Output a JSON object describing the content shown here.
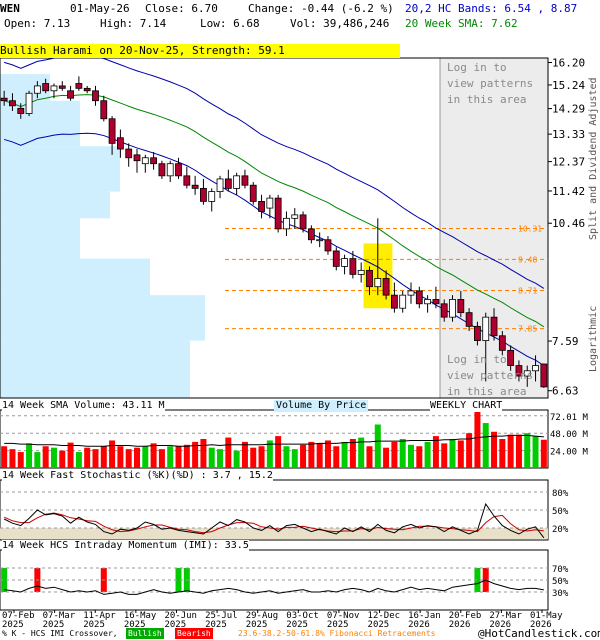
{
  "header": {
    "ticker": "WEN",
    "date": "01-May-26",
    "close": "Close: 6.70",
    "change": "Change: -0.44 (-6.2 %)",
    "open": "Open: 7.13",
    "high": "High: 7.14",
    "low": "Low: 6.68",
    "volume": "Vol: 39,486,246",
    "bands": "20,2 HC Bands: 6.54 , 8.87",
    "sma": "20 Week SMA: 7.62"
  },
  "banner": "Bullish Harami on 20-Nov-25, Strength: 59.1",
  "login_text": "Log in to\nview patterns\nin this area",
  "price_axis_label": "Split and Dividend Adjusted",
  "log_label": "Logarithmic",
  "volume_title": "14 Week SMA Volume: 43.11 M",
  "vbp_label": "Volume By Price",
  "weekly_label": "WEEKLY CHART",
  "stoch_title": "14 Week Fast Stochastic (%K)(%D) : 3.7 , 15.2",
  "hmi_title": "14 Week HCS Intraday Momentum (IMI): 33.5",
  "footer": {
    "legend_text": "% K - HCS IMI Crossover,",
    "bullish": "Bullish",
    "bearish": "Bearish",
    "fib": "23.6-38.2-50-61.8% Fibonacci Retracements",
    "copyright": "@HotCandlestick.com"
  },
  "colors": {
    "bull": "#00cc00",
    "bear": "#ff0000",
    "candle_bear": "#b00030",
    "sma": "#008800",
    "bands": "#0000aa",
    "fib": "#ff8000",
    "vbp": "#cfefff",
    "highlight": "#ffee00",
    "stoch_k": "#000000",
    "stoch_d": "#cc0000"
  },
  "chart_data": [
    {
      "type": "candlestick",
      "ticker": "WEN",
      "scale": "log",
      "ylim": [
        6.5,
        16.4
      ],
      "y_ticks": [
        16.2,
        15.24,
        14.29,
        13.33,
        12.37,
        11.42,
        10.46,
        7.59,
        6.63
      ],
      "x_labels": [
        "07-Feb\n2025",
        "07-Mar\n2025",
        "11-Apr\n2025",
        "16-May\n2025",
        "20-Jun\n2025",
        "25-Jul\n2025",
        "29-Aug\n2025",
        "03-Oct\n2025",
        "07-Nov\n2025",
        "12-Dec\n2025",
        "16-Jan\n2026",
        "20-Feb\n2026",
        "27-Mar\n2026",
        "01-May\n2026"
      ],
      "fib_levels": [
        10.31,
        9.48,
        8.71,
        7.85
      ],
      "weeks": 66,
      "ohlc": [
        [
          14.7,
          15.0,
          14.4,
          14.6
        ],
        [
          14.6,
          14.9,
          14.2,
          14.4
        ],
        [
          14.3,
          14.5,
          13.9,
          14.1
        ],
        [
          14.1,
          15.0,
          14.0,
          14.9
        ],
        [
          14.9,
          15.4,
          14.7,
          15.2
        ],
        [
          15.3,
          15.5,
          14.9,
          15.0
        ],
        [
          15.0,
          15.3,
          14.7,
          15.2
        ],
        [
          15.2,
          15.4,
          15.0,
          15.1
        ],
        [
          15.0,
          15.2,
          14.6,
          14.7
        ],
        [
          15.3,
          15.6,
          15.0,
          15.1
        ],
        [
          15.1,
          15.2,
          14.9,
          15.0
        ],
        [
          15.0,
          15.2,
          14.4,
          14.6
        ],
        [
          14.6,
          14.8,
          13.8,
          13.9
        ],
        [
          13.9,
          14.0,
          12.6,
          13.0
        ],
        [
          13.2,
          13.5,
          12.5,
          12.8
        ],
        [
          12.8,
          13.0,
          12.2,
          12.5
        ],
        [
          12.6,
          12.8,
          12.0,
          12.4
        ],
        [
          12.3,
          12.6,
          12.0,
          12.5
        ],
        [
          12.5,
          12.7,
          12.1,
          12.3
        ],
        [
          12.3,
          12.4,
          11.8,
          11.9
        ],
        [
          11.9,
          12.4,
          11.7,
          12.3
        ],
        [
          12.3,
          12.5,
          11.8,
          11.9
        ],
        [
          11.9,
          12.2,
          11.5,
          11.6
        ],
        [
          11.6,
          11.9,
          11.3,
          11.5
        ],
        [
          11.5,
          11.8,
          11.0,
          11.1
        ],
        [
          11.1,
          11.5,
          10.8,
          11.4
        ],
        [
          11.4,
          11.9,
          11.2,
          11.8
        ],
        [
          11.8,
          12.1,
          11.4,
          11.5
        ],
        [
          11.5,
          12.0,
          11.3,
          11.9
        ],
        [
          11.9,
          12.1,
          11.5,
          11.6
        ],
        [
          11.6,
          11.7,
          11.0,
          11.1
        ],
        [
          11.1,
          11.3,
          10.6,
          10.8
        ],
        [
          10.9,
          11.3,
          10.6,
          11.2
        ],
        [
          11.2,
          11.3,
          10.2,
          10.3
        ],
        [
          10.3,
          10.8,
          10.1,
          10.6
        ],
        [
          10.6,
          10.9,
          10.3,
          10.7
        ],
        [
          10.7,
          10.8,
          10.2,
          10.3
        ],
        [
          10.3,
          10.4,
          9.9,
          10.0
        ],
        [
          10.0,
          10.2,
          9.8,
          10.0
        ],
        [
          10.0,
          10.1,
          9.6,
          9.7
        ],
        [
          9.7,
          9.8,
          9.2,
          9.3
        ],
        [
          9.3,
          9.6,
          9.1,
          9.5
        ],
        [
          9.5,
          9.7,
          9.0,
          9.1
        ],
        [
          9.1,
          9.4,
          8.9,
          9.2
        ],
        [
          9.2,
          9.3,
          8.6,
          8.8
        ],
        [
          8.8,
          10.6,
          8.6,
          9.0
        ],
        [
          9.0,
          9.2,
          8.5,
          8.6
        ],
        [
          8.6,
          8.9,
          8.2,
          8.3
        ],
        [
          8.3,
          8.7,
          8.2,
          8.6
        ],
        [
          8.6,
          8.9,
          8.4,
          8.7
        ],
        [
          8.7,
          8.8,
          8.3,
          8.4
        ],
        [
          8.4,
          8.6,
          8.2,
          8.5
        ],
        [
          8.5,
          8.8,
          8.3,
          8.4
        ],
        [
          8.4,
          8.5,
          8.0,
          8.1
        ],
        [
          8.1,
          8.6,
          8.0,
          8.5
        ],
        [
          8.5,
          8.7,
          8.1,
          8.2
        ],
        [
          8.2,
          8.3,
          7.8,
          7.9
        ],
        [
          7.9,
          8.0,
          7.5,
          7.6
        ],
        [
          7.6,
          8.2,
          6.8,
          8.1
        ],
        [
          8.1,
          8.3,
          7.6,
          7.7
        ],
        [
          7.7,
          7.8,
          7.3,
          7.4
        ],
        [
          7.4,
          7.5,
          7.0,
          7.1
        ],
        [
          7.1,
          7.2,
          6.8,
          6.9
        ],
        [
          6.9,
          7.1,
          6.7,
          7.0
        ],
        [
          7.0,
          7.3,
          6.8,
          7.1
        ],
        [
          7.13,
          7.14,
          6.68,
          6.7
        ]
      ]
    },
    {
      "type": "bar",
      "title": "14 Week SMA Volume: 43.11 M",
      "y_ticks": [
        72.01,
        48.0,
        24.0
      ],
      "y_tick_labels": [
        "72.01 M",
        "48.00 M",
        "24.00 M"
      ],
      "ylim": [
        0,
        80
      ],
      "values": [
        30,
        26,
        22,
        34,
        22,
        30,
        28,
        24,
        35,
        22,
        28,
        26,
        30,
        38,
        30,
        26,
        28,
        30,
        34,
        26,
        30,
        30,
        32,
        36,
        40,
        28,
        26,
        42,
        24,
        36,
        28,
        30,
        38,
        44,
        30,
        26,
        32,
        36,
        34,
        38,
        30,
        36,
        40,
        42,
        30,
        60,
        28,
        36,
        40,
        32,
        30,
        36,
        44,
        34,
        40,
        38,
        48,
        80,
        62,
        50,
        40,
        46,
        46,
        48,
        44,
        39
      ],
      "up": [
        false,
        false,
        false,
        true,
        true,
        false,
        true,
        false,
        false,
        true,
        false,
        false,
        false,
        false,
        false,
        false,
        false,
        true,
        false,
        false,
        true,
        false,
        false,
        false,
        false,
        true,
        true,
        false,
        true,
        false,
        false,
        false,
        true,
        false,
        true,
        true,
        false,
        false,
        false,
        false,
        false,
        true,
        false,
        true,
        false,
        true,
        false,
        false,
        true,
        true,
        false,
        true,
        false,
        false,
        true,
        false,
        false,
        false,
        true,
        false,
        false,
        false,
        false,
        true,
        true,
        false
      ],
      "sma": [
        34,
        34,
        33,
        33,
        32,
        32,
        32,
        31,
        31,
        31,
        30,
        30,
        30,
        31,
        31,
        31,
        30,
        30,
        31,
        31,
        31,
        30,
        30,
        31,
        31,
        32,
        31,
        32,
        32,
        32,
        32,
        32,
        33,
        33,
        33,
        33,
        33,
        33,
        34,
        34,
        34,
        35,
        35,
        36,
        36,
        37,
        37,
        37,
        37,
        38,
        38,
        38,
        38,
        39,
        39,
        40,
        40,
        42,
        43,
        44,
        44,
        45,
        45,
        45,
        44,
        43
      ]
    },
    {
      "type": "line",
      "title": "14 Week Fast Stochastic (%K)(%D) : 3.7 , 15.2",
      "y_ticks": [
        80,
        50,
        20
      ],
      "y_tick_labels": [
        "80%",
        "50%",
        "20%"
      ],
      "ylim": [
        0,
        100
      ],
      "series": [
        {
          "name": "%K",
          "values": [
            35,
            28,
            24,
            36,
            50,
            42,
            44,
            40,
            28,
            38,
            30,
            26,
            14,
            10,
            18,
            16,
            20,
            30,
            26,
            18,
            20,
            16,
            14,
            12,
            10,
            20,
            30,
            24,
            34,
            30,
            20,
            16,
            24,
            14,
            24,
            26,
            20,
            14,
            18,
            14,
            10,
            20,
            14,
            22,
            14,
            26,
            16,
            12,
            22,
            26,
            20,
            24,
            22,
            14,
            22,
            16,
            10,
            16,
            60,
            40,
            24,
            16,
            10,
            18,
            22,
            3.7
          ]
        },
        {
          "name": "%D",
          "values": [
            38,
            32,
            29,
            29,
            37,
            43,
            45,
            42,
            37,
            35,
            32,
            31,
            23,
            17,
            14,
            15,
            18,
            22,
            25,
            25,
            21,
            18,
            17,
            14,
            12,
            14,
            20,
            25,
            29,
            29,
            28,
            22,
            20,
            18,
            21,
            21,
            23,
            20,
            17,
            15,
            14,
            15,
            15,
            19,
            17,
            21,
            19,
            18,
            17,
            20,
            23,
            23,
            22,
            20,
            19,
            17,
            16,
            14,
            29,
            39,
            41,
            27,
            17,
            15,
            17,
            15.2
          ]
        }
      ]
    },
    {
      "type": "line",
      "title": "14 Week HCS Intraday Momentum (IMI): 33.5",
      "y_ticks": [
        70,
        50,
        30
      ],
      "y_tick_labels": [
        "70%",
        "50%",
        "30%"
      ],
      "ylim": [
        0,
        100
      ],
      "values": [
        34,
        32,
        30,
        36,
        40,
        36,
        38,
        34,
        30,
        32,
        30,
        32,
        26,
        28,
        30,
        26,
        26,
        30,
        34,
        30,
        28,
        30,
        32,
        30,
        28,
        32,
        34,
        36,
        34,
        30,
        28,
        30,
        32,
        28,
        30,
        32,
        34,
        30,
        30,
        32,
        30,
        34,
        36,
        34,
        30,
        36,
        32,
        30,
        34,
        38,
        34,
        36,
        34,
        32,
        38,
        40,
        42,
        44,
        50,
        44,
        40,
        36,
        34,
        36,
        36,
        33.5
      ],
      "crossover_bars": [
        {
          "index": 0,
          "signal": "bullish"
        },
        {
          "index": 4,
          "signal": "bearish"
        },
        {
          "index": 12,
          "signal": "bearish"
        },
        {
          "index": 21,
          "signal": "bullish"
        },
        {
          "index": 22,
          "signal": "bullish"
        },
        {
          "index": 57,
          "signal": "bullish"
        },
        {
          "index": 58,
          "signal": "bearish"
        }
      ]
    }
  ]
}
